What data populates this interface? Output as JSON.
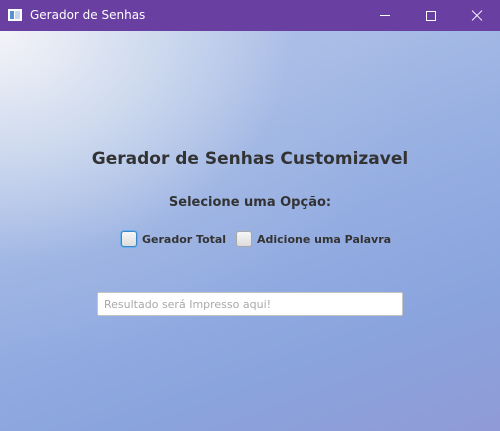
{
  "window": {
    "title": "Gerador de Senhas",
    "icon": "app-window-icon",
    "controls": [
      "minimize-icon",
      "maximize-icon",
      "close-icon"
    ],
    "titlebar_color": "#6a3fa2"
  },
  "main": {
    "heading": "Gerador de Senhas Customizavel",
    "prompt": "Selecione uma Opção:",
    "options": [
      {
        "label": "Gerador Total",
        "checked": false,
        "focused": true
      },
      {
        "label": "Adicione uma Palavra",
        "checked": false,
        "focused": false
      }
    ],
    "result": {
      "value": "",
      "placeholder": "Resultado será Impresso aqui!"
    }
  }
}
